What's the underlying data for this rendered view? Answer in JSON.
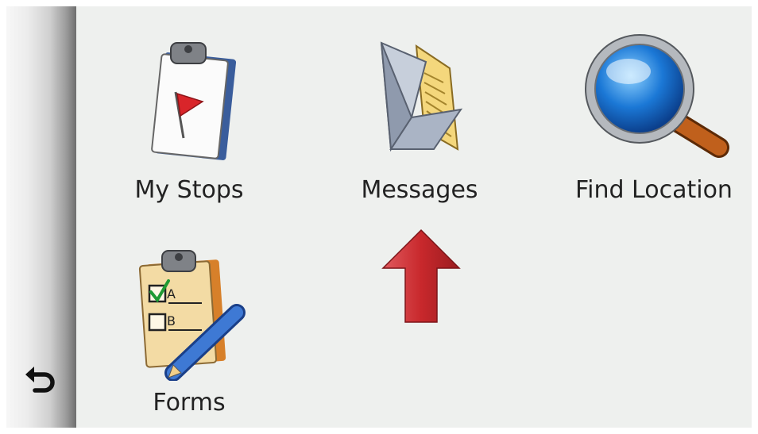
{
  "navigation": {
    "back_icon": "back-arrow-icon"
  },
  "menu": {
    "items": [
      {
        "label": "My Stops",
        "icon": "clipboard-flag-icon"
      },
      {
        "label": "Messages",
        "icon": "envelope-icon"
      },
      {
        "label": "Find Location",
        "icon": "magnifying-glass-icon"
      },
      {
        "label": "Forms",
        "icon": "forms-clipboard-pencil-icon"
      }
    ]
  },
  "annotation": {
    "icon": "red-up-arrow-icon",
    "color": "#c8282c"
  },
  "colors": {
    "background": "#eef0ee",
    "text": "#222222"
  }
}
